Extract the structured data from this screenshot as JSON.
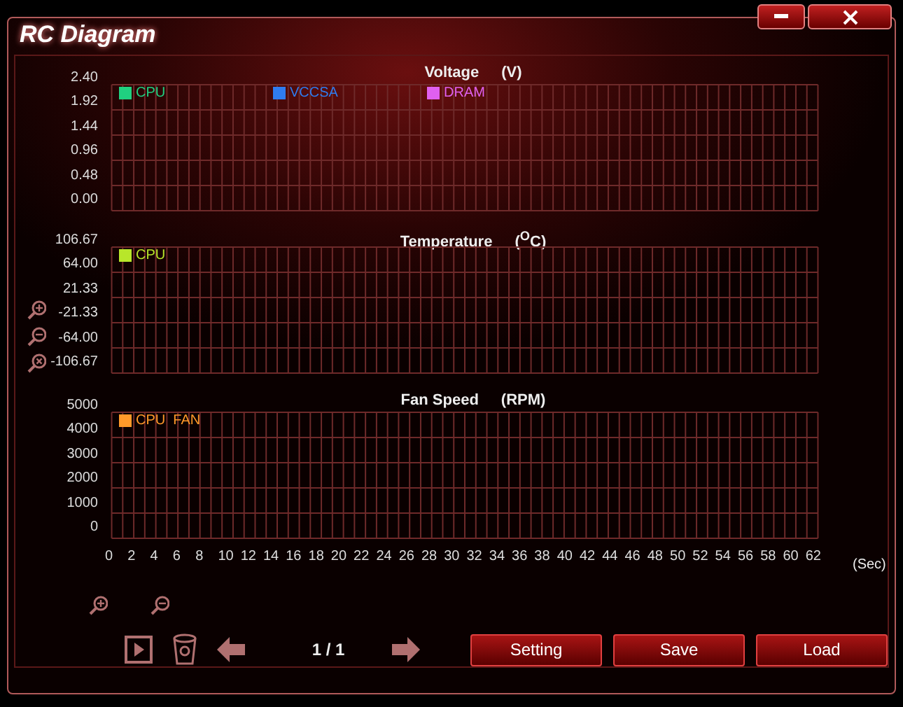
{
  "window": {
    "title": "RC Diagram"
  },
  "charts": [
    {
      "title": "Voltage",
      "unit": "(V)",
      "zoom_tools": false,
      "y_labels": [
        "2.40",
        "1.92",
        "1.44",
        "0.96",
        "0.48",
        "0.00"
      ],
      "legend": [
        {
          "label": "CPU",
          "color": "#20d080"
        },
        {
          "label": "VCCSA",
          "color": "#2f7cf0"
        },
        {
          "label": "DRAM",
          "color": "#e060f0"
        }
      ]
    },
    {
      "title": "Temperature",
      "unit": "($^{O}$C)",
      "zoom_tools": true,
      "y_labels": [
        "106.67",
        "64.00",
        "21.33",
        "-21.33",
        "-64.00",
        "-106.67"
      ],
      "legend": [
        {
          "label": "CPU",
          "color": "#b8e62a"
        }
      ]
    },
    {
      "title": "Fan Speed",
      "unit": "(RPM)",
      "zoom_tools": false,
      "y_labels": [
        "5000",
        "4000",
        "3000",
        "2000",
        "1000",
        "0"
      ],
      "legend": [
        {
          "label": "CPU  FAN",
          "color": "#ff9a2a"
        }
      ],
      "x_labels": [
        "0",
        "2",
        "4",
        "6",
        "8",
        "10",
        "12",
        "14",
        "16",
        "18",
        "20",
        "22",
        "24",
        "26",
        "28",
        "30",
        "32",
        "34",
        "36",
        "38",
        "40",
        "42",
        "44",
        "46",
        "48",
        "50",
        "52",
        "54",
        "56",
        "58",
        "60",
        "62"
      ],
      "x_unit": "(Sec)"
    }
  ],
  "pager": "1 / 1",
  "buttons": [
    "Setting",
    "Save",
    "Load"
  ]
}
